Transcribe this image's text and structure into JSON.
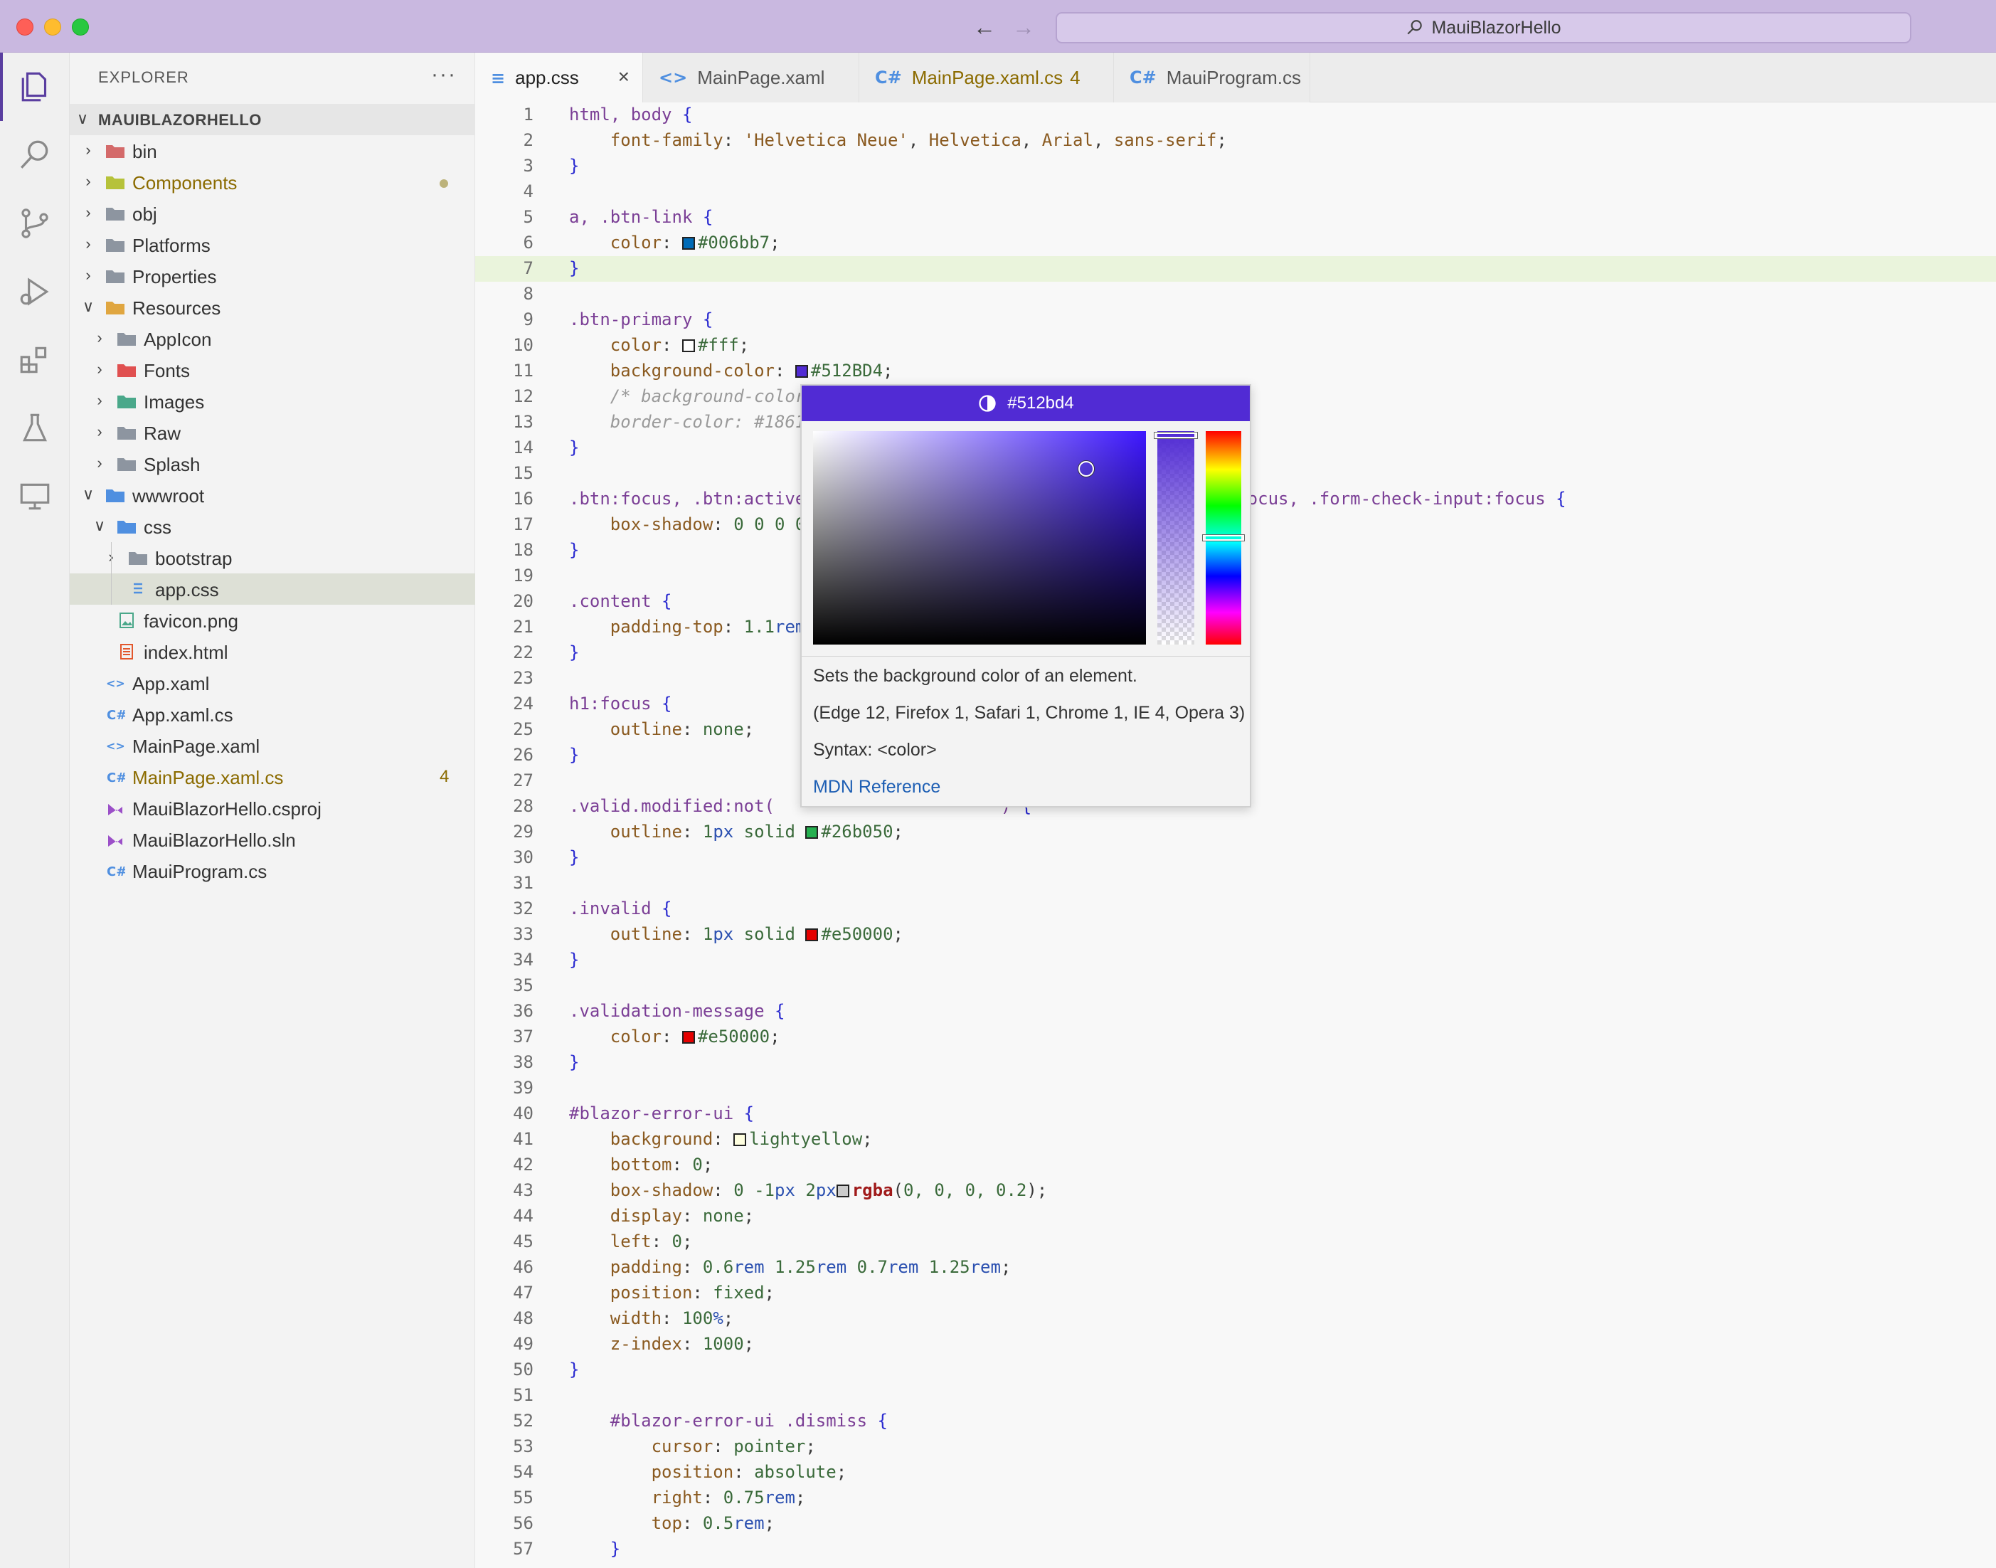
{
  "window": {
    "search_text": "MauiBlazorHello"
  },
  "activity_bar": [
    "explorer-icon",
    "search-icon",
    "source-control-icon",
    "run-debug-icon",
    "extensions-icon",
    "testing-icon",
    "remote-explorer-icon"
  ],
  "sidebar": {
    "title": "EXPLORER",
    "more": "···",
    "root": "MAUIBLAZORHELLO",
    "items": [
      {
        "label": "bin",
        "depth": 0,
        "type": "folder",
        "chev": ">"
      },
      {
        "label": "Components",
        "depth": 0,
        "type": "folder",
        "chev": ">",
        "modified": true
      },
      {
        "label": "obj",
        "depth": 0,
        "type": "folder",
        "chev": ">"
      },
      {
        "label": "Platforms",
        "depth": 0,
        "type": "folder",
        "chev": ">"
      },
      {
        "label": "Properties",
        "depth": 0,
        "type": "folder",
        "chev": ">"
      },
      {
        "label": "Resources",
        "depth": 0,
        "type": "folder-open",
        "chev": "v"
      },
      {
        "label": "AppIcon",
        "depth": 1,
        "type": "folder",
        "chev": ">"
      },
      {
        "label": "Fonts",
        "depth": 1,
        "type": "folder",
        "chev": ">"
      },
      {
        "label": "Images",
        "depth": 1,
        "type": "folder",
        "chev": ">"
      },
      {
        "label": "Raw",
        "depth": 1,
        "type": "folder",
        "chev": ">"
      },
      {
        "label": "Splash",
        "depth": 1,
        "type": "folder",
        "chev": ">"
      },
      {
        "label": "wwwroot",
        "depth": 0,
        "type": "folder-open",
        "chev": "v"
      },
      {
        "label": "css",
        "depth": 1,
        "type": "folder-open",
        "chev": "v"
      },
      {
        "label": "bootstrap",
        "depth": 2,
        "type": "folder",
        "chev": ">"
      },
      {
        "label": "app.css",
        "depth": 2,
        "type": "css",
        "chev": "",
        "selected": true
      },
      {
        "label": "favicon.png",
        "depth": 1,
        "type": "image",
        "chev": ""
      },
      {
        "label": "index.html",
        "depth": 1,
        "type": "html",
        "chev": ""
      },
      {
        "label": "App.xaml",
        "depth": 0,
        "type": "xaml",
        "chev": ""
      },
      {
        "label": "App.xaml.cs",
        "depth": 0,
        "type": "csharp",
        "chev": ""
      },
      {
        "label": "MainPage.xaml",
        "depth": 0,
        "type": "xaml",
        "chev": ""
      },
      {
        "label": "MainPage.xaml.cs",
        "depth": 0,
        "type": "csharp",
        "chev": "",
        "badge": "4"
      },
      {
        "label": "MauiBlazorHello.csproj",
        "depth": 0,
        "type": "vs",
        "chev": ""
      },
      {
        "label": "MauiBlazorHello.sln",
        "depth": 0,
        "type": "vs",
        "chev": ""
      },
      {
        "label": "MauiProgram.cs",
        "depth": 0,
        "type": "csharp",
        "chev": ""
      }
    ]
  },
  "tabs": [
    {
      "label": "app.css",
      "icon": "css",
      "active": true,
      "close": "×"
    },
    {
      "label": "MainPage.xaml",
      "icon": "xaml"
    },
    {
      "label": "MainPage.xaml.cs",
      "icon": "csharp",
      "badge": "4",
      "modified": true
    },
    {
      "label": "MauiProgram.cs",
      "icon": "csharp"
    }
  ],
  "editor": {
    "current_line": 7,
    "lines": [
      [
        [
          "sel",
          "html, body "
        ],
        [
          "brace",
          "{"
        ]
      ],
      [
        [
          "",
          "    "
        ],
        [
          "prop",
          "font-family"
        ],
        [
          "",
          ": "
        ],
        [
          "str",
          "'Helvetica Neue'"
        ],
        [
          "",
          ", "
        ],
        [
          "str",
          "Helvetica"
        ],
        [
          "",
          ", "
        ],
        [
          "str",
          "Arial"
        ],
        [
          "",
          ", "
        ],
        [
          "str",
          "sans-serif"
        ],
        [
          "",
          ";"
        ]
      ],
      [
        [
          "brace",
          "}"
        ]
      ],
      [],
      [
        [
          "sel",
          "a, .btn-link "
        ],
        [
          "brace",
          "{"
        ]
      ],
      [
        [
          "",
          "    "
        ],
        [
          "prop",
          "color"
        ],
        [
          "",
          ": "
        ],
        [
          "swatch",
          "#006bb7"
        ],
        [
          "val",
          "#006bb7"
        ],
        [
          "",
          ";"
        ]
      ],
      [
        [
          "brace",
          "}"
        ]
      ],
      [],
      [
        [
          "sel",
          ".btn-primary "
        ],
        [
          "brace",
          "{"
        ]
      ],
      [
        [
          "",
          "    "
        ],
        [
          "prop",
          "color"
        ],
        [
          "",
          ": "
        ],
        [
          "swatch",
          "#ffffff"
        ],
        [
          "val",
          "#fff"
        ],
        [
          "",
          ";"
        ]
      ],
      [
        [
          "",
          "    "
        ],
        [
          "prop",
          "background-color"
        ],
        [
          "",
          ": "
        ],
        [
          "swatch",
          "#512BD4"
        ],
        [
          "val",
          "#512BD4"
        ],
        [
          "",
          ";"
        ]
      ],
      [
        [
          "",
          "    "
        ],
        [
          "cmt",
          "/* background-color"
        ]
      ],
      [
        [
          "",
          "    "
        ],
        [
          "cmt",
          "border-color: #1861"
        ]
      ],
      [
        [
          "brace",
          "}"
        ]
      ],
      [],
      [
        [
          "sel",
          ".btn:focus, .btn:active"
        ],
        [
          "",
          "                                     "
        ],
        [
          "sel",
          "trol:focus, .form-check-input:focus "
        ],
        [
          "brace",
          "{"
        ]
      ],
      [
        [
          "",
          "    "
        ],
        [
          "prop",
          "box-shadow"
        ],
        [
          "",
          ": "
        ],
        [
          "num",
          "0 0 0 0"
        ]
      ],
      [
        [
          "brace",
          "}"
        ]
      ],
      [],
      [
        [
          "sel",
          ".content "
        ],
        [
          "brace",
          "{"
        ]
      ],
      [
        [
          "",
          "    "
        ],
        [
          "prop",
          "padding-top"
        ],
        [
          "",
          ": "
        ],
        [
          "num",
          "1.1"
        ],
        [
          "unit",
          "rem"
        ]
      ],
      [
        [
          "brace",
          "}"
        ]
      ],
      [],
      [
        [
          "sel",
          "h1:focus "
        ],
        [
          "brace",
          "{"
        ]
      ],
      [
        [
          "",
          "    "
        ],
        [
          "prop",
          "outline"
        ],
        [
          "",
          ": "
        ],
        [
          "val",
          "none"
        ],
        [
          "",
          ";"
        ]
      ],
      [
        [
          "brace",
          "}"
        ]
      ],
      [],
      [
        [
          "sel",
          ".valid.modified:not("
        ],
        [
          "",
          "                      "
        ],
        [
          "sel",
          ") "
        ],
        [
          "brace",
          "{"
        ]
      ],
      [
        [
          "",
          "    "
        ],
        [
          "prop",
          "outline"
        ],
        [
          "",
          ": "
        ],
        [
          "num",
          "1"
        ],
        [
          "unit",
          "px"
        ],
        [
          "val",
          " solid "
        ],
        [
          "swatch",
          "#26b050"
        ],
        [
          "val",
          "#26b050"
        ],
        [
          "",
          ";"
        ]
      ],
      [
        [
          "brace",
          "}"
        ]
      ],
      [],
      [
        [
          "sel",
          ".invalid "
        ],
        [
          "brace",
          "{"
        ]
      ],
      [
        [
          "",
          "    "
        ],
        [
          "prop",
          "outline"
        ],
        [
          "",
          ": "
        ],
        [
          "num",
          "1"
        ],
        [
          "unit",
          "px"
        ],
        [
          "val",
          " solid "
        ],
        [
          "swatch",
          "#e50000"
        ],
        [
          "val",
          "#e50000"
        ],
        [
          "",
          ";"
        ]
      ],
      [
        [
          "brace",
          "}"
        ]
      ],
      [],
      [
        [
          "sel",
          ".validation-message "
        ],
        [
          "brace",
          "{"
        ]
      ],
      [
        [
          "",
          "    "
        ],
        [
          "prop",
          "color"
        ],
        [
          "",
          ": "
        ],
        [
          "swatch",
          "#e50000"
        ],
        [
          "val",
          "#e50000"
        ],
        [
          "",
          ";"
        ]
      ],
      [
        [
          "brace",
          "}"
        ]
      ],
      [],
      [
        [
          "sel",
          "#blazor-error-ui "
        ],
        [
          "brace",
          "{"
        ]
      ],
      [
        [
          "",
          "    "
        ],
        [
          "prop",
          "background"
        ],
        [
          "",
          ": "
        ],
        [
          "swatch",
          "#ffffe0"
        ],
        [
          "val",
          "lightyellow"
        ],
        [
          "",
          ";"
        ]
      ],
      [
        [
          "",
          "    "
        ],
        [
          "prop",
          "bottom"
        ],
        [
          "",
          ": "
        ],
        [
          "num",
          "0"
        ],
        [
          "",
          ";"
        ]
      ],
      [
        [
          "",
          "    "
        ],
        [
          "prop",
          "box-shadow"
        ],
        [
          "",
          ": "
        ],
        [
          "num",
          "0 -1"
        ],
        [
          "unit",
          "px"
        ],
        [
          "num",
          " 2"
        ],
        [
          "unit",
          "px"
        ],
        [
          "",
          ""
        ],
        [
          "swatch",
          "#cccccc"
        ],
        [
          "fn",
          "rgba"
        ],
        [
          "",
          "("
        ],
        [
          "num",
          "0, 0, 0, 0.2"
        ],
        [
          "",
          ");"
        ]
      ],
      [
        [
          "",
          "    "
        ],
        [
          "prop",
          "display"
        ],
        [
          "",
          ": "
        ],
        [
          "val",
          "none"
        ],
        [
          "",
          ";"
        ]
      ],
      [
        [
          "",
          "    "
        ],
        [
          "prop",
          "left"
        ],
        [
          "",
          ": "
        ],
        [
          "num",
          "0"
        ],
        [
          "",
          ";"
        ]
      ],
      [
        [
          "",
          "    "
        ],
        [
          "prop",
          "padding"
        ],
        [
          "",
          ": "
        ],
        [
          "num",
          "0.6"
        ],
        [
          "unit",
          "rem"
        ],
        [
          "num",
          " 1.25"
        ],
        [
          "unit",
          "rem"
        ],
        [
          "num",
          " 0.7"
        ],
        [
          "unit",
          "rem"
        ],
        [
          "num",
          " 1.25"
        ],
        [
          "unit",
          "rem"
        ],
        [
          "",
          ";"
        ]
      ],
      [
        [
          "",
          "    "
        ],
        [
          "prop",
          "position"
        ],
        [
          "",
          ": "
        ],
        [
          "val",
          "fixed"
        ],
        [
          "",
          ";"
        ]
      ],
      [
        [
          "",
          "    "
        ],
        [
          "prop",
          "width"
        ],
        [
          "",
          ": "
        ],
        [
          "num",
          "100"
        ],
        [
          "unit",
          "%"
        ],
        [
          "",
          ";"
        ]
      ],
      [
        [
          "",
          "    "
        ],
        [
          "prop",
          "z-index"
        ],
        [
          "",
          ": "
        ],
        [
          "num",
          "1000"
        ],
        [
          "",
          ";"
        ]
      ],
      [
        [
          "brace",
          "}"
        ]
      ],
      [],
      [
        [
          "",
          "    "
        ],
        [
          "sel",
          "#blazor-error-ui .dismiss "
        ],
        [
          "brace",
          "{"
        ]
      ],
      [
        [
          "",
          "        "
        ],
        [
          "prop",
          "cursor"
        ],
        [
          "",
          ": "
        ],
        [
          "val",
          "pointer"
        ],
        [
          "",
          ";"
        ]
      ],
      [
        [
          "",
          "        "
        ],
        [
          "prop",
          "position"
        ],
        [
          "",
          ": "
        ],
        [
          "val",
          "absolute"
        ],
        [
          "",
          ";"
        ]
      ],
      [
        [
          "",
          "        "
        ],
        [
          "prop",
          "right"
        ],
        [
          "",
          ": "
        ],
        [
          "num",
          "0.75"
        ],
        [
          "unit",
          "rem"
        ],
        [
          "",
          ";"
        ]
      ],
      [
        [
          "",
          "        "
        ],
        [
          "prop",
          "top"
        ],
        [
          "",
          ": "
        ],
        [
          "num",
          "0.5"
        ],
        [
          "unit",
          "rem"
        ],
        [
          "",
          ";"
        ]
      ],
      [
        [
          "",
          "    "
        ],
        [
          "brace",
          "}"
        ]
      ]
    ]
  },
  "color_picker": {
    "header": "#512bd4",
    "color": "#512bd4",
    "description": "Sets the background color of an element.",
    "compat": "(Edge 12, Firefox 1, Safari 1, Chrome 1, IE 4, Opera 3)",
    "syntax": "Syntax: <color>",
    "link": "MDN Reference"
  }
}
